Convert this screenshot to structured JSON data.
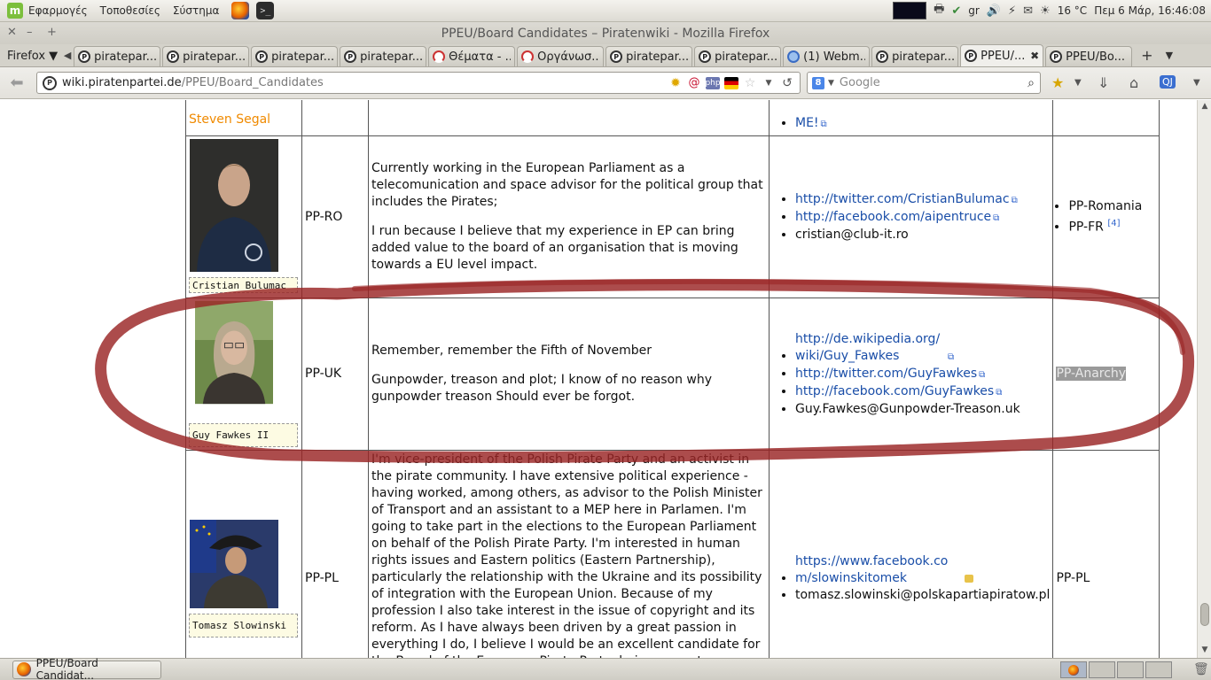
{
  "os_panel": {
    "menus": [
      "Εφαρμογές",
      "Τοποθεσίες",
      "Σύστημα"
    ],
    "keyboard_layout": "gr",
    "temperature": "16 °C",
    "clock": "Πεμ  6 Μάρ, 16:46:08"
  },
  "window": {
    "title": "PPEU/Board Candidates – Piratenwiki - Mozilla Firefox"
  },
  "tabs": {
    "menu_label": "Firefox ▼",
    "items": [
      {
        "label": "piratepar...",
        "icon": "pirate-icon"
      },
      {
        "label": "piratepar...",
        "icon": "pirate-icon"
      },
      {
        "label": "piratepar...",
        "icon": "pirate-icon"
      },
      {
        "label": "piratepar...",
        "icon": "pirate-icon"
      },
      {
        "label": "Θέματα - ...",
        "icon": "forum-icon"
      },
      {
        "label": "Οργάνωσ...",
        "icon": "forum-icon"
      },
      {
        "label": "piratepar...",
        "icon": "pirate-icon"
      },
      {
        "label": "piratepar...",
        "icon": "pirate-icon"
      },
      {
        "label": "(1) Webm...",
        "icon": "webmail-icon"
      },
      {
        "label": "piratepar...",
        "icon": "pirate-icon"
      },
      {
        "label": "PPEU/...",
        "icon": "pirate-icon",
        "active": true
      },
      {
        "label": "PPEU/Bo...",
        "icon": "pirate-icon"
      }
    ]
  },
  "nav": {
    "url_domain": "wiki.piratenpartei.de",
    "url_path": "/PPEU/Board_Candidates",
    "search_placeholder": "Google"
  },
  "candidates": [
    {
      "name": "Steven Segal",
      "partial_link": "ME!"
    },
    {
      "photo_label": "Cristian Bulumac",
      "party": "PP-RO",
      "description": [
        "Currently working in the European Parliament as a telecomunication and space advisor for the political group that includes the Pirates;",
        "I run because I believe that my experience in EP can bring added value to the board of an organisation that is moving towards a EU level impact."
      ],
      "links": [
        "http://twitter.com/CristianBulumac",
        "http://facebook.com/aipentruce"
      ],
      "email": "cristian@club-it.ro",
      "supporters": [
        "PP-Romania",
        "PP-FR"
      ],
      "footnote": "[4]"
    },
    {
      "photo_label": "Guy Fawkes II",
      "party": "PP-UK",
      "description": [
        "Remember, remember the Fifth of November",
        "Gunpowder, treason and plot; I know of no reason why gunpowder treason Should ever be forgot."
      ],
      "links": [
        "http://de.wikipedia.org/wiki/Guy_Fawkes",
        "http://twitter.com/GuyFawkes",
        "http://facebook.com/GuyFawkes"
      ],
      "email": "Guy.Fawkes@Gunpowder-Treason.uk",
      "supporters_text": "PP-Anarchy"
    },
    {
      "photo_label": "Tomasz Slowinski",
      "party": "PP-PL",
      "description": "I'm vice-president of the Polish Pirate Party and an activist in the pirate community. I have extensive political experience - having worked, among others, as advisor to the Polish Minister of Transport and an assistant to a MEP here in Parlamen. I'm going to take part in the elections to the European Parliament on behalf of the Polish Pirate Party. I'm interested in human rights issues and Eastern politics (Eastern Partnership), particularly the relationship with the Ukraine and its possibility of integration with the European Union. Because of my profession I also take interest in the issue of copyright and its reform. As I have always been driven by a great passion in everything I do, I believe I would be an excellent candidate for the Board of the European Pirate Party, being a great representative of not only Poland but also the countries of the so-called New Union!",
      "links": [
        "https://www.facebook.com/slowinskitomek"
      ],
      "email": "tomasz.slowinski@polskapartiapiratow.pl",
      "supporters_text": "PP-PL"
    }
  ],
  "taskbar": {
    "window_button": "PPEU/Board Candidat..."
  }
}
